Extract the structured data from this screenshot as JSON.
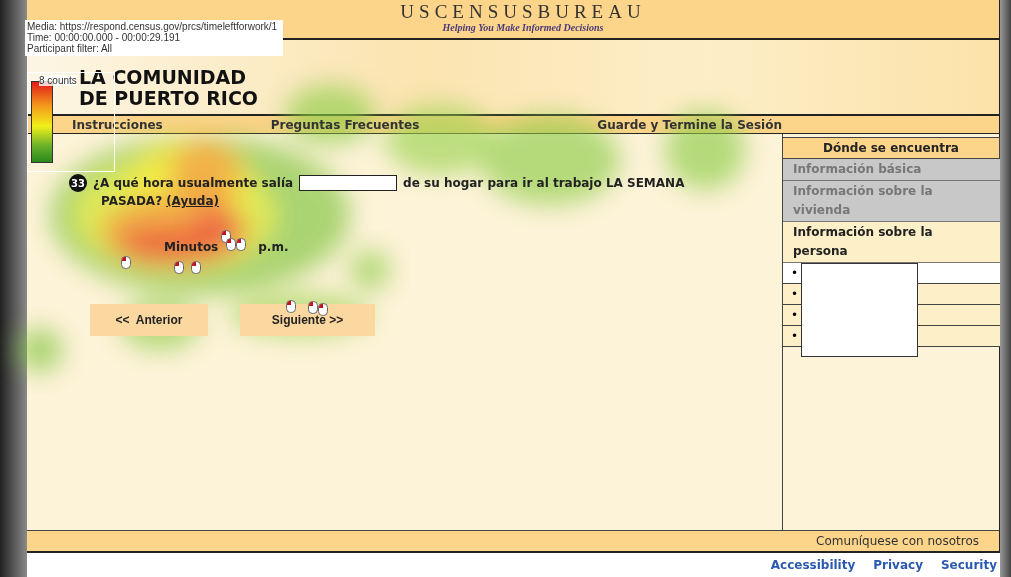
{
  "overlay_info": {
    "lines": [
      "Media: https://respond.census.gov/prcs/timeleftforwork/1",
      "Time: 00:00:00.000 - 00:00:29.191",
      "Participant filter: All"
    ]
  },
  "legend": {
    "label": "8 counts"
  },
  "header": {
    "title": "USCENSUSBUREAU",
    "tagline": "Helping You Make Informed Decisions"
  },
  "hero": {
    "lines": [
      "LA COMUNIDAD",
      "DE PUERTO RICO"
    ]
  },
  "nav": [
    {
      "label": "Instrucciones"
    },
    {
      "label": "Preguntas Frecuentes"
    },
    {
      "label": "Guarde y Termine la Sesión"
    }
  ],
  "question": {
    "number": "33",
    "before": "¿A qué hora usualmente salía",
    "after": "de su hogar para ir al trabajo LA SEMANA",
    "after_2": "PASADA?",
    "help_link": "(Ayuda)"
  },
  "time_parts": [
    "Minutos",
    "p.m."
  ],
  "buttons": [
    {
      "label": "<<  Anterior"
    },
    {
      "label": "Siguiente >>"
    }
  ],
  "sidebar": {
    "title": "Dónde se encuentra",
    "sections": [
      {
        "label": "Información básica",
        "selected": false
      },
      {
        "label": "Información sobre la vivienda",
        "selected": false
      },
      {
        "label": "Información sobre la persona",
        "selected": true
      }
    ],
    "subitems": [
      {
        "bullet": "•",
        "selected": true
      },
      {
        "bullet": "•",
        "selected": false
      },
      {
        "bullet": "•",
        "selected": false
      },
      {
        "bullet": "•",
        "selected": false
      }
    ]
  },
  "footer": {
    "contact": "Comuníquese con nosotros"
  },
  "links": [
    "Accessibility",
    "Privacy",
    "Security"
  ]
}
